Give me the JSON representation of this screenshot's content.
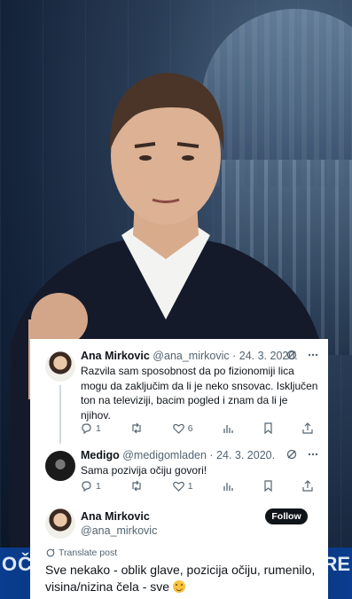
{
  "background": {
    "strip_left": "OČI",
    "strip_right": "RE"
  },
  "tweets": [
    {
      "name": "Ana Mirkovic",
      "handle": "@ana_mirkovic",
      "date": "· 24. 3. 2020.",
      "text": "Razvila sam sposobnost da po fizionomiji lica mogu da zaključim da li je neko snsovac. Isključen ton na televiziji, bacim pogled i znam da li je njihov.",
      "replies": "1",
      "likes": "6"
    },
    {
      "name": "Medigo",
      "handle": "@medigomladen",
      "date": "· 24. 3. 2020.",
      "text": "Sama pozivija očiju govori!",
      "replies": "1",
      "likes": "1"
    }
  ],
  "main_tweet": {
    "name": "Ana Mirkovic",
    "handle": "@ana_mirkovic",
    "follow_label": "Follow",
    "translate_label": "Translate post",
    "text": "Sve nekako - oblik glave, pozicija očiju, rumenilo, visina/nizina čela - sve"
  },
  "colors": {
    "text": "#0f1419",
    "secondary": "#536471",
    "follow_bg": "#0f1419",
    "strip": "#0a3d8f"
  },
  "icons": [
    "reply-icon",
    "retweet-icon",
    "like-icon",
    "views-icon",
    "bookmark-icon",
    "share-icon",
    "grok-icon",
    "more-icon",
    "translate-icon",
    "grin-emoji"
  ]
}
